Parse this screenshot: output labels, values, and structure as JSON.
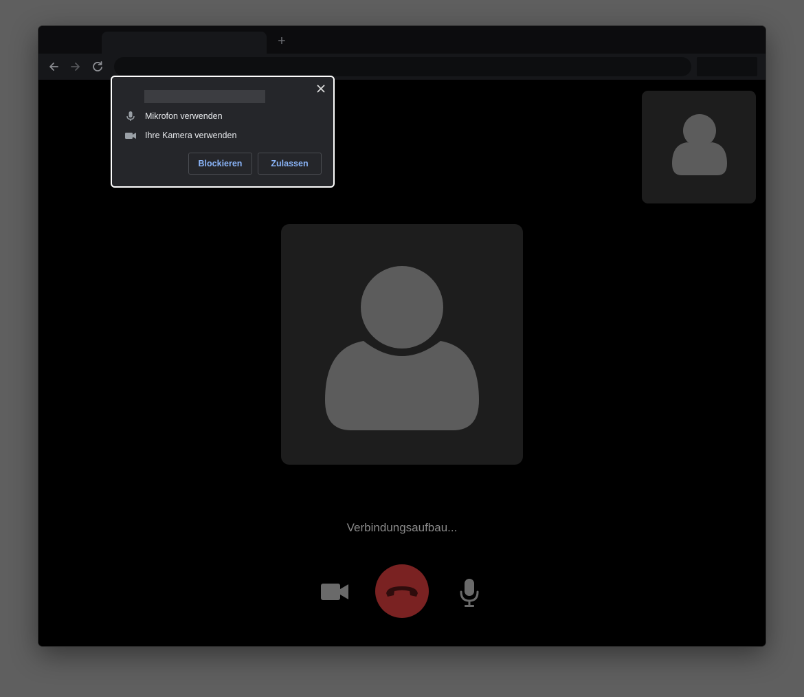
{
  "browser": {
    "newtab_symbol": "+",
    "back_icon": "arrow-left-icon",
    "forward_icon": "arrow-right-icon",
    "reload_icon": "reload-icon"
  },
  "permission_prompt": {
    "items": [
      {
        "icon": "microphone-icon",
        "label": "Mikrofon verwenden"
      },
      {
        "icon": "camera-icon",
        "label": "Ihre Kamera verwenden"
      }
    ],
    "block_label": "Blockieren",
    "allow_label": "Zulassen",
    "close_icon": "close-icon",
    "accent_color": "#8ab4f8"
  },
  "call": {
    "status_text": "Verbindungsaufbau...",
    "controls": [
      {
        "name": "camera-icon"
      },
      {
        "name": "hangup-icon",
        "color": "#7a2222"
      },
      {
        "name": "microphone-icon"
      }
    ]
  }
}
